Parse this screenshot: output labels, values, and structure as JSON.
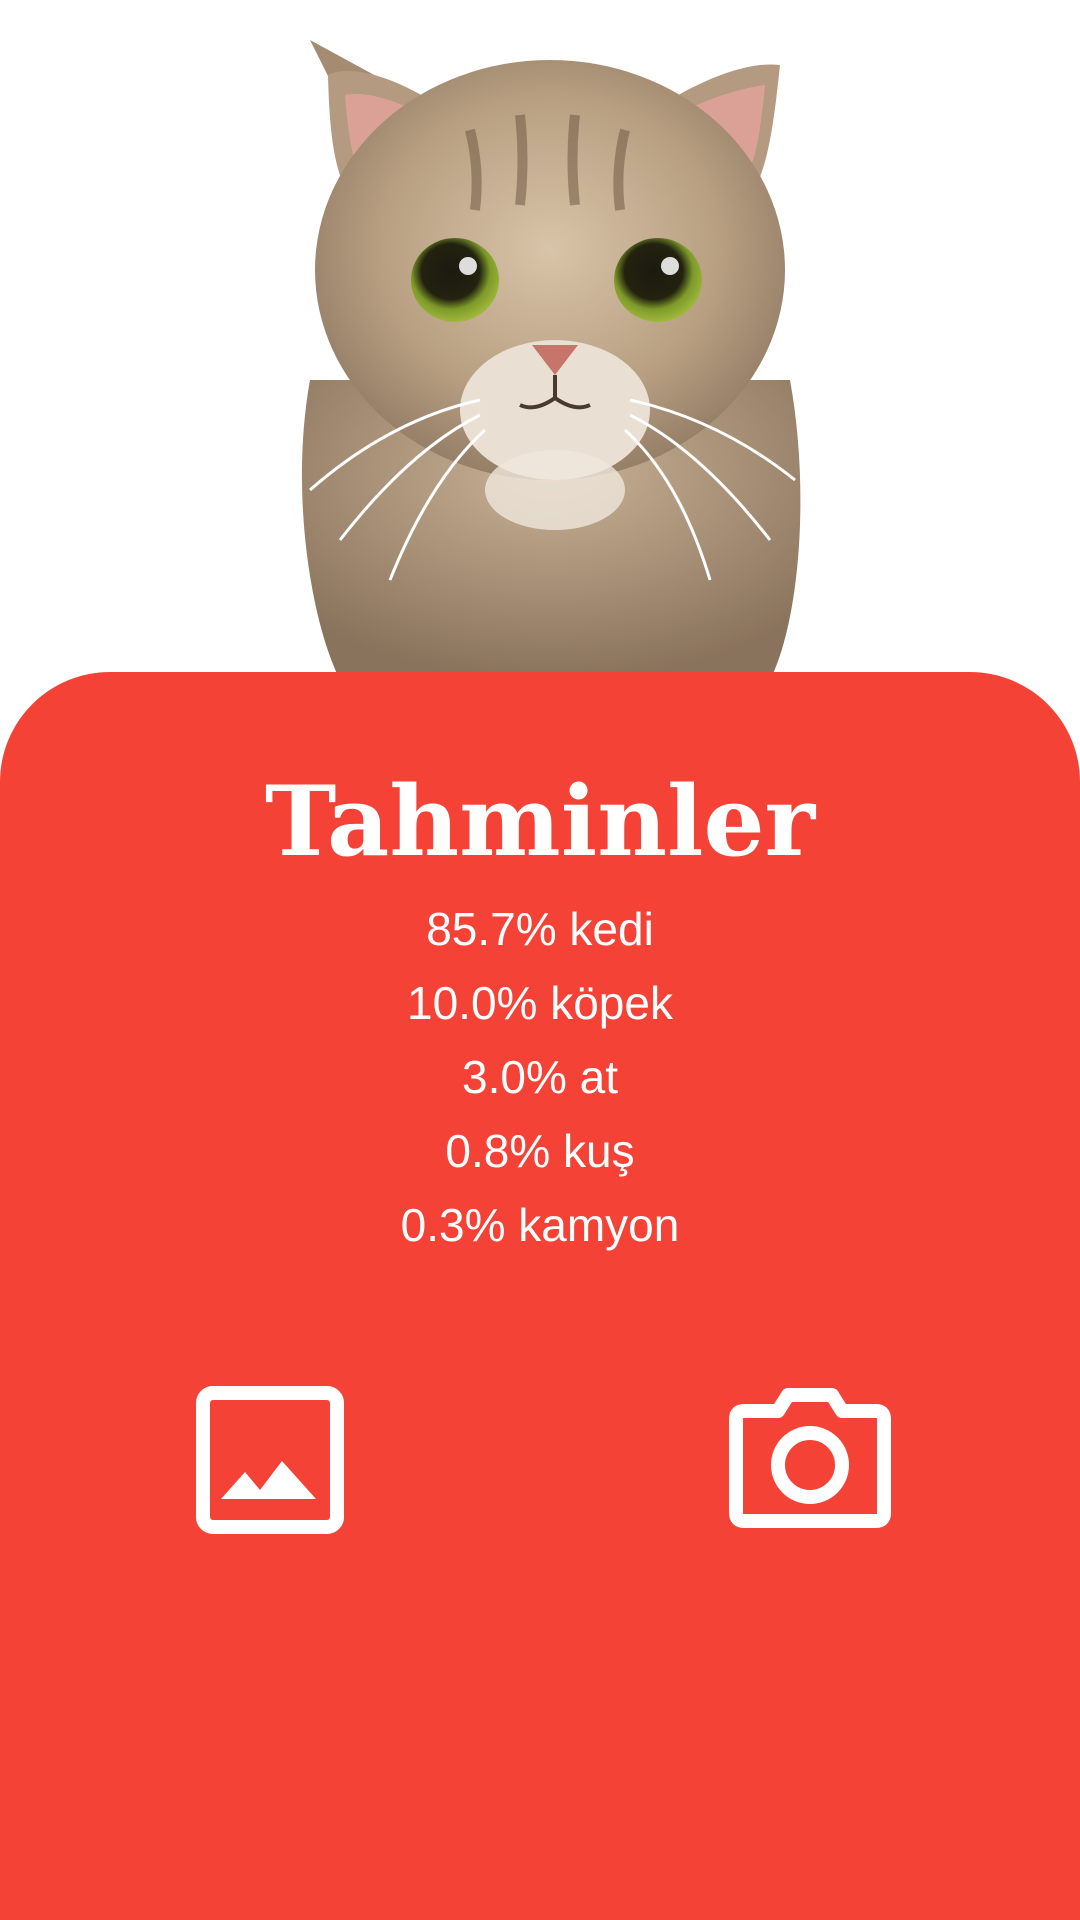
{
  "theme": {
    "accent": "#f44336",
    "on_accent": "#ffffff"
  },
  "photo": {
    "subject": "cat-photo"
  },
  "results": {
    "title": "Tahminler",
    "predictions": [
      {
        "text": "85.7% kedi"
      },
      {
        "text": "10.0% köpek"
      },
      {
        "text": "3.0% at"
      },
      {
        "text": "0.8% kuş"
      },
      {
        "text": "0.3% kamyon"
      }
    ]
  },
  "actions": {
    "gallery_icon": "image-gallery-icon",
    "camera_icon": "camera-icon"
  }
}
